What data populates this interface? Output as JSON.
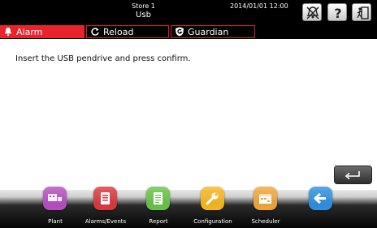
{
  "header": {
    "store": "Store 1",
    "title": "Usb",
    "datetime": "2014/01/01  12:00",
    "buttons": [
      {
        "name": "alarm-bell-button",
        "icon": "bell-off-icon"
      },
      {
        "name": "help-button",
        "icon": "question-icon"
      },
      {
        "name": "logout-button",
        "icon": "door-exit-icon"
      }
    ]
  },
  "tabs": {
    "alarm": "Alarm",
    "reload": "Reload",
    "guardian": "Guardian"
  },
  "main": {
    "message": "Insert the USB pendrive and press confirm."
  },
  "confirm_button": {
    "icon": "enter-arrow-icon"
  },
  "nav": [
    {
      "label": "Plant",
      "icon": "plant-icon",
      "color": "#b44fc0"
    },
    {
      "label": "Alarms/Events",
      "icon": "alarms-icon",
      "color": "#d8383f"
    },
    {
      "label": "Report",
      "icon": "report-icon",
      "color": "#6ac24a"
    },
    {
      "label": "Configuration",
      "icon": "wrench-icon",
      "color": "#f5b622"
    },
    {
      "label": "Scheduler",
      "icon": "scheduler-icon",
      "color": "#f0a53a"
    },
    {
      "label": "",
      "icon": "back-arrow-icon",
      "color": "#2f8fe0"
    }
  ],
  "colors": {
    "accent_red": "#e8232b",
    "tab_border": "#d02020",
    "background": "#000000",
    "content_bg": "#ffffff"
  }
}
